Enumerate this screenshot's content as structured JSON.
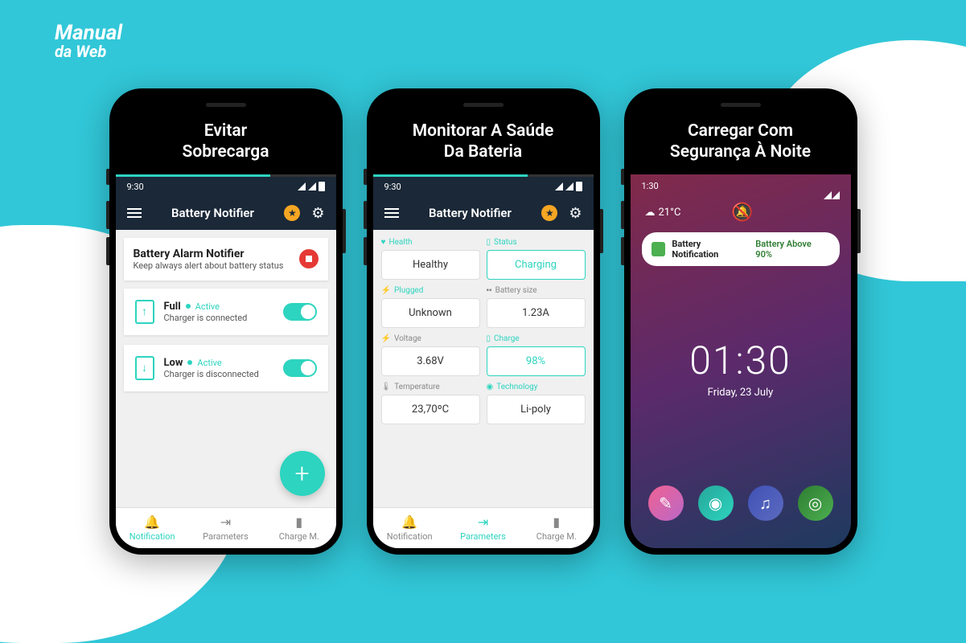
{
  "brand": {
    "line1": "Manual",
    "line2": "da Web"
  },
  "phone1": {
    "title": "Evitar\nSobrecarga",
    "statusTime": "9:30",
    "appTitle": "Battery Notifier",
    "alert": {
      "title": "Battery Alarm Notifier",
      "sub": "Keep always alert about battery status"
    },
    "full": {
      "label": "Full",
      "active": "Active",
      "sub": "Charger is connected"
    },
    "low": {
      "label": "Low",
      "active": "Active",
      "sub": "Charger is disconnected"
    },
    "nav": [
      "Notification",
      "Parameters",
      "Charge M."
    ]
  },
  "phone2": {
    "title": "Monitorar A Saúde\nDa Bateria",
    "statusTime": "9:30",
    "appTitle": "Battery Notifier",
    "params": {
      "health": {
        "label": "Health",
        "value": "Healthy"
      },
      "status": {
        "label": "Status",
        "value": "Charging"
      },
      "plugged": {
        "label": "Plugged",
        "value": "Unknown"
      },
      "batterySize": {
        "label": "Battery size",
        "value": "1.23A"
      },
      "voltage": {
        "label": "Voltage",
        "value": "3.68V"
      },
      "charge": {
        "label": "Charge",
        "value": "98%"
      },
      "temperature": {
        "label": "Temperature",
        "value": "23,70ºC"
      },
      "technology": {
        "label": "Technology",
        "value": "Li-poly"
      }
    },
    "nav": [
      "Notification",
      "Parameters",
      "Charge M."
    ]
  },
  "phone3": {
    "title": "Carregar Com\nSegurança À Noite",
    "statusTime": "1:30",
    "temp": "21°C",
    "notif": {
      "title": "Battery Notification",
      "msg": "Battery Above 90%"
    },
    "clock": "01:30",
    "date": "Friday, 23 July"
  }
}
